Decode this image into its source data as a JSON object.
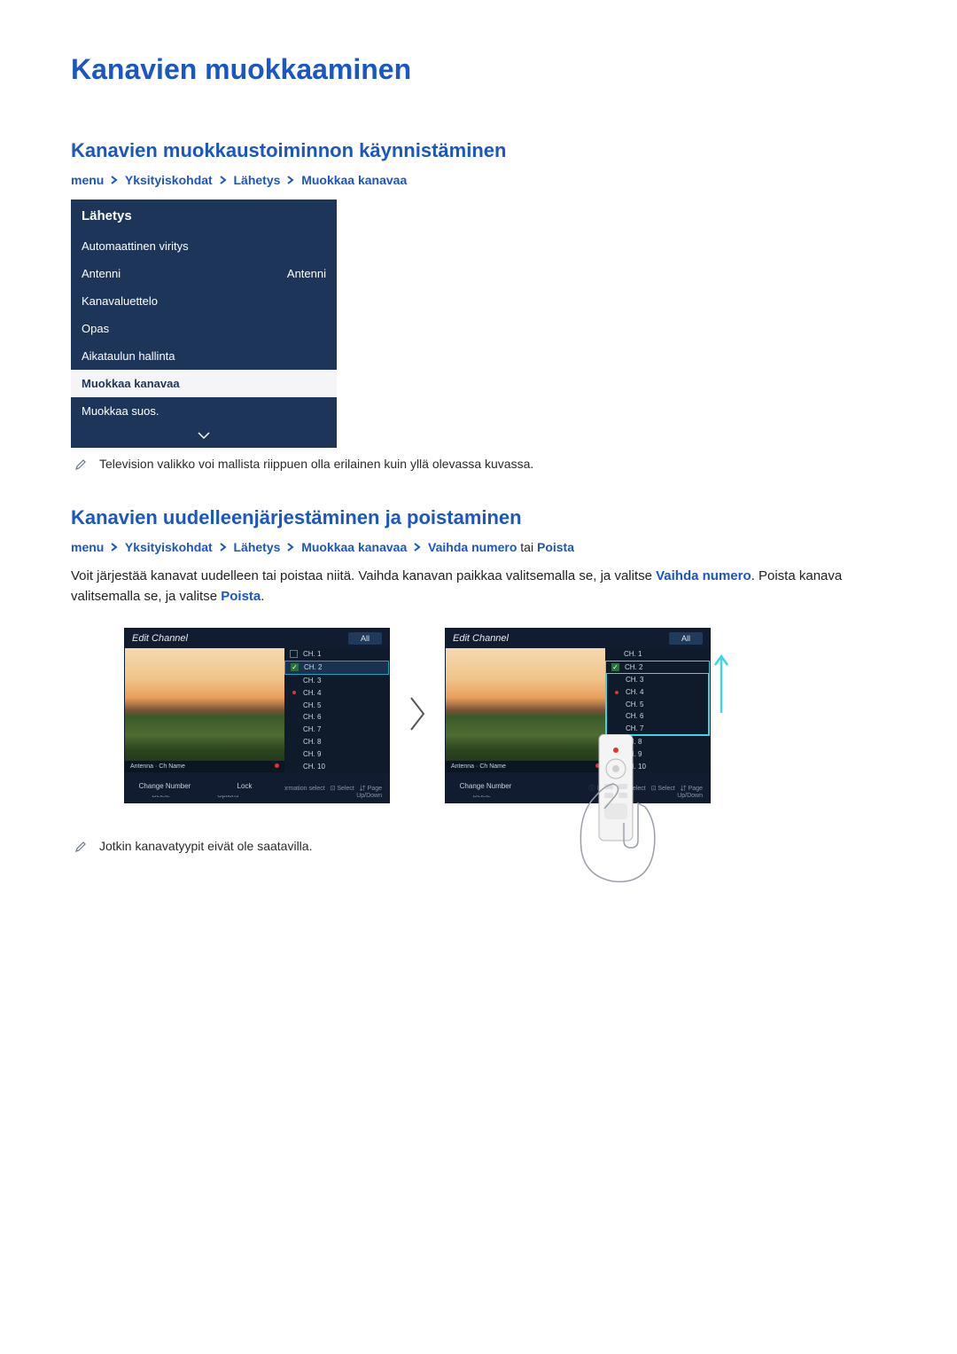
{
  "page": {
    "title": "Kanavien muokkaaminen"
  },
  "section1": {
    "heading": "Kanavien muokkaustoiminnon käynnistäminen",
    "crumb": [
      "menu",
      "Yksityiskohdat",
      "Lähetys",
      "Muokkaa kanavaa"
    ],
    "note": "Television valikko voi mallista riippuen olla erilainen kuin yllä olevassa kuvassa."
  },
  "menu": {
    "header": "Lähetys",
    "items": [
      {
        "label": "Automaattinen viritys",
        "value": ""
      },
      {
        "label": "Antenni",
        "value": "Antenni"
      },
      {
        "label": "Kanavaluettelo",
        "value": ""
      },
      {
        "label": "Opas",
        "value": ""
      },
      {
        "label": "Aikataulun hallinta",
        "value": ""
      },
      {
        "label": "Muokkaa kanavaa",
        "value": "",
        "selected": true
      },
      {
        "label": "Muokkaa suos.",
        "value": ""
      }
    ]
  },
  "section2": {
    "heading": "Kanavien uudelleenjärjestäminen ja poistaminen",
    "crumb": [
      "menu",
      "Yksityiskohdat",
      "Lähetys",
      "Muokkaa kanavaa",
      "Vaihda numero"
    ],
    "crumb_tail_plain": "tai",
    "crumb_tail_hl": "Poista",
    "body_pre": "Voit järjestää kanavat uudelleen tai poistaa niitä. Vaihda kanavan paikkaa valitsemalla se, ja valitse ",
    "body_hl1": "Vaihda numero",
    "body_mid": ". Poista kanava valitsemalla se, ja valitse ",
    "body_hl2": "Poista",
    "body_post": ".",
    "note": "Jotkin kanavatyypit eivät ole saatavilla."
  },
  "tv": {
    "title": "Edit Channel",
    "pill": "All",
    "info_label": "Antenna",
    "info_sub": "Ch Name",
    "buttons_left": [
      "Change Number",
      "Delete"
    ],
    "buttons_right": [
      "Lock",
      "Options"
    ],
    "channels": [
      "CH. 1",
      "CH. 2",
      "CH. 3",
      "CH. 4",
      "CH. 5",
      "CH. 6",
      "CH. 7",
      "CH. 8",
      "CH. 9",
      "CH. 10"
    ],
    "footer": [
      "Information  select",
      "Select",
      "Page Up/Down"
    ]
  }
}
